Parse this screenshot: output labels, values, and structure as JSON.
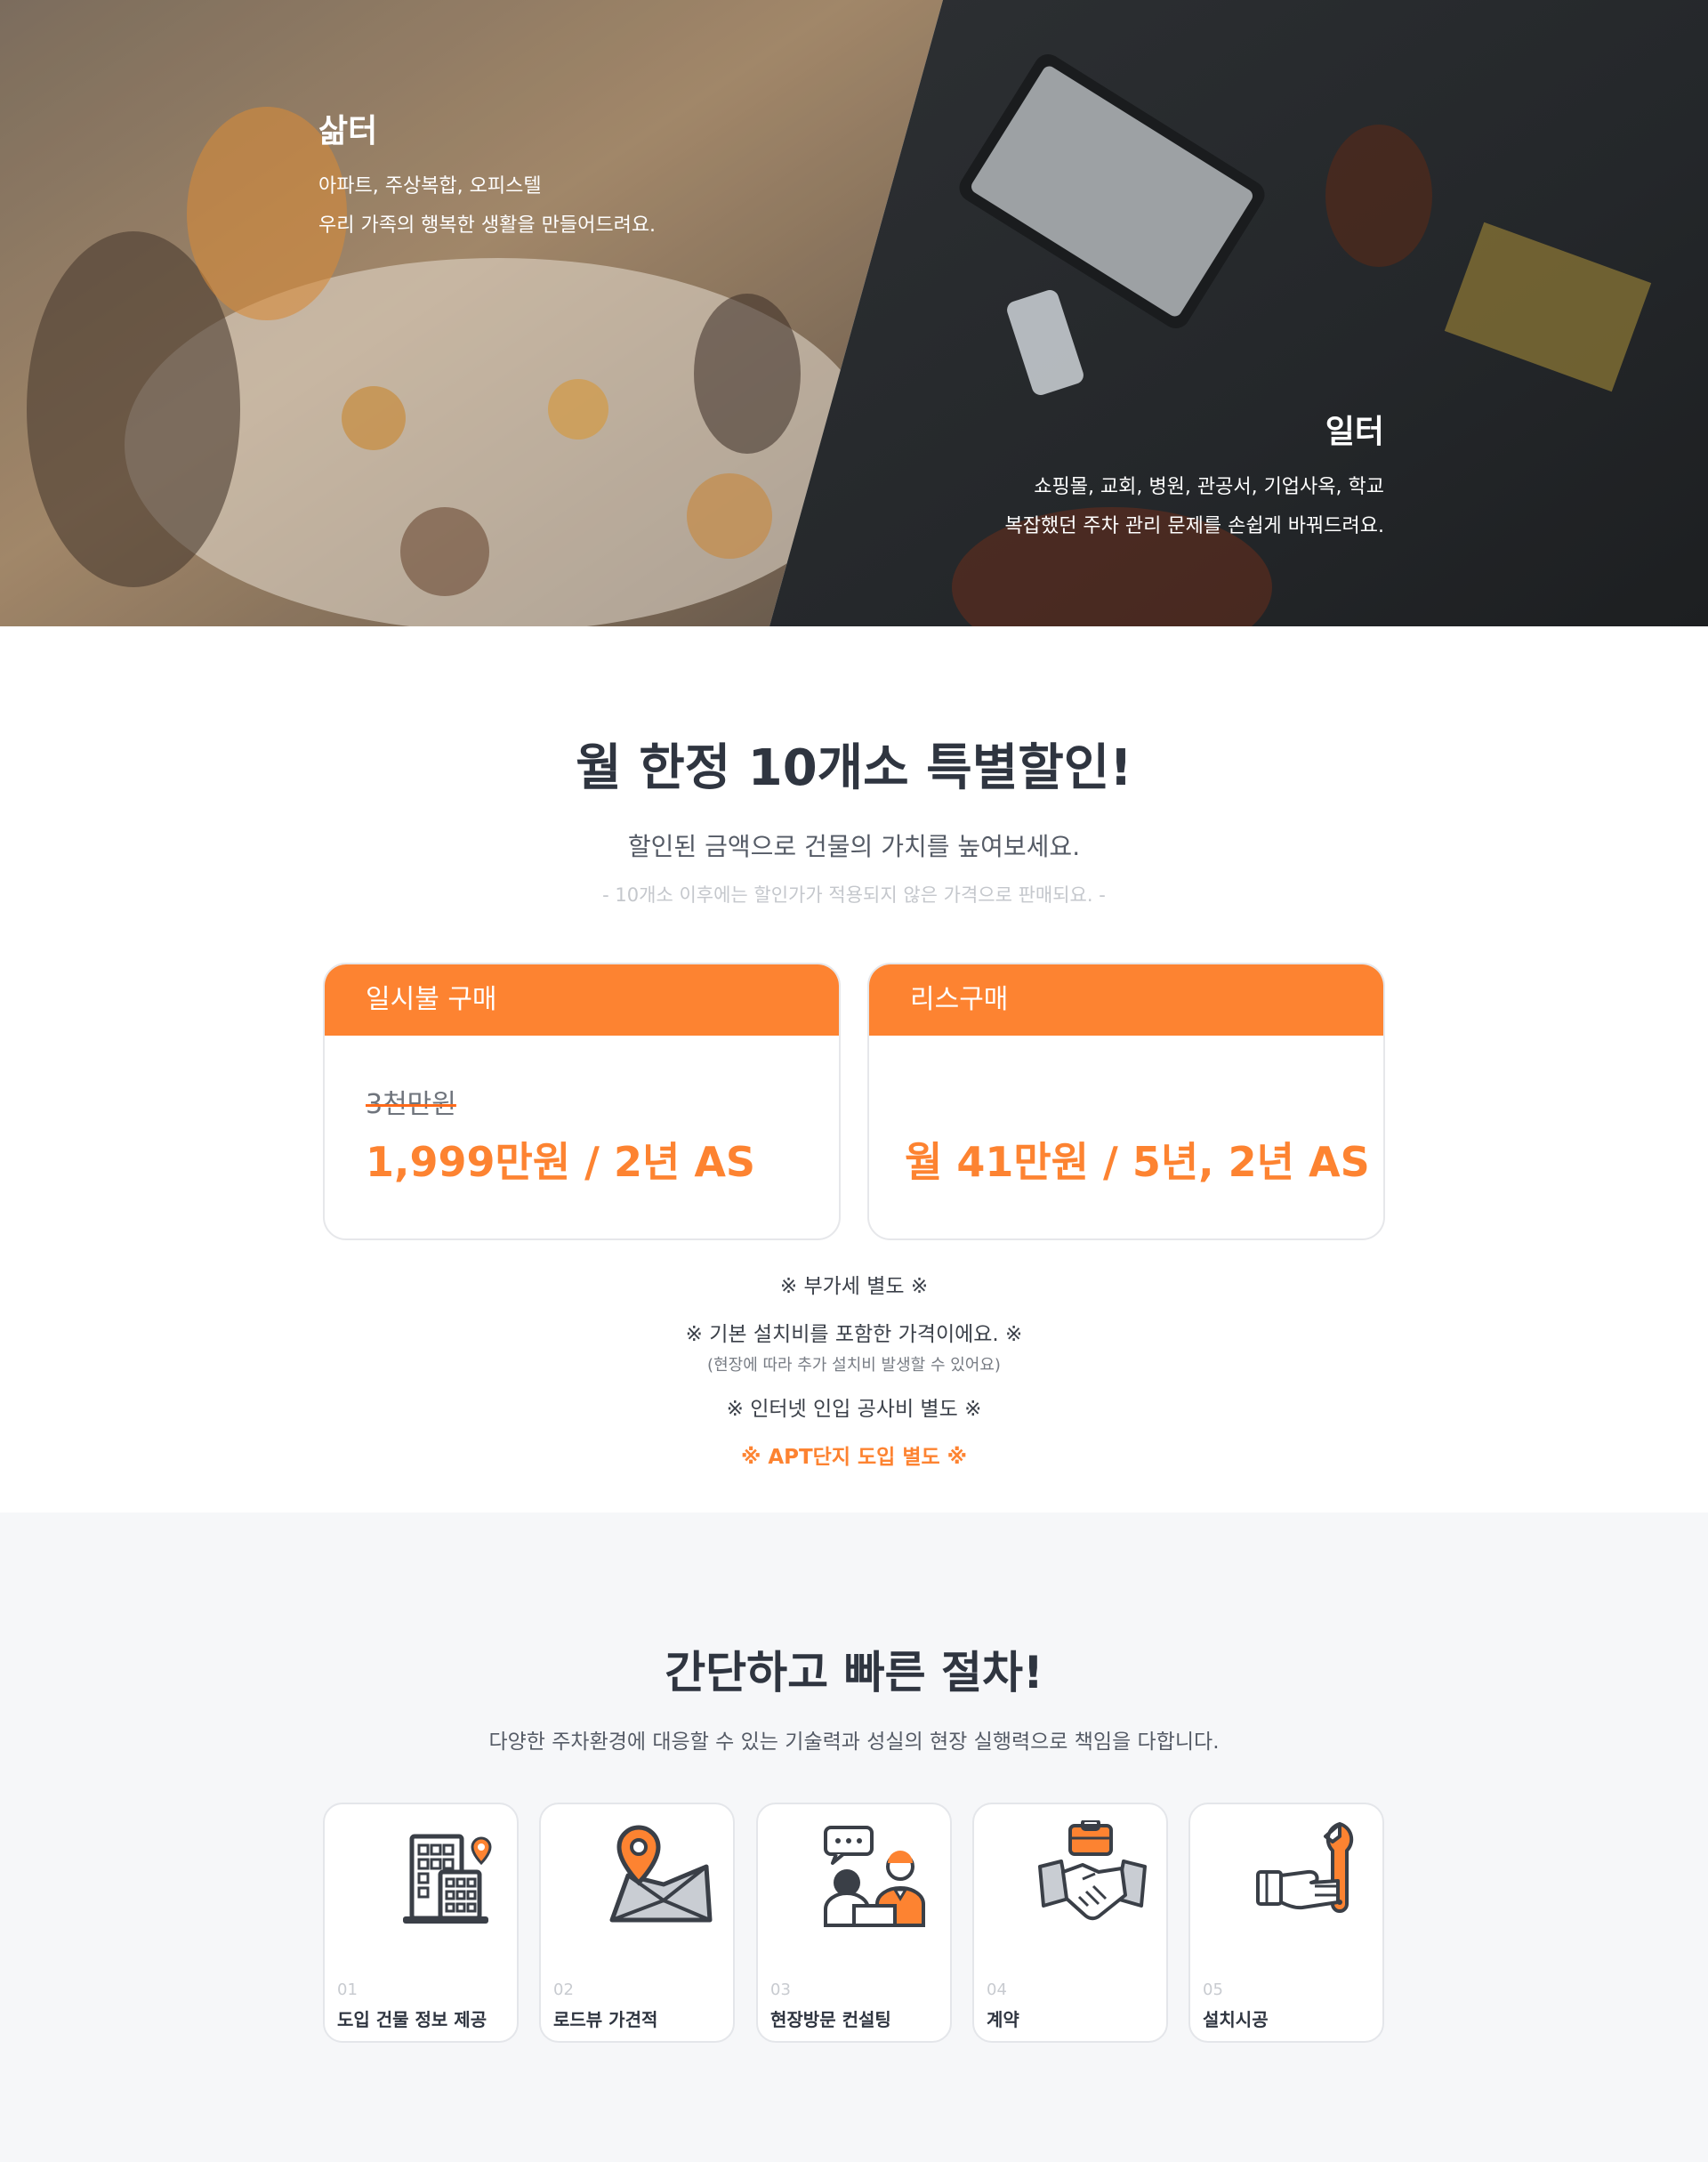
{
  "hero": {
    "left": {
      "title": "삶터",
      "line1": "아파트, 주상복합, 오피스텔",
      "line2": "우리 가족의 행복한 생활을 만들어드려요."
    },
    "right": {
      "title": "일터",
      "line1": "쇼핑몰, 교회, 병원, 관공서, 기업사옥, 학교",
      "line2": "복잡했던 주차 관리 문제를 손쉽게 바꿔드려요."
    }
  },
  "pricing": {
    "title": "월 한정 10개소 특별할인!",
    "subtitle": "할인된 금액으로 건물의 가치를 높여보세요.",
    "note": "- 10개소 이후에는 할인가가 적용되지 않은 가격으로 판매되요. -",
    "cards": [
      {
        "title": "일시불 구매",
        "old_price": "3천만원",
        "price": "1,999만원 / 2년 AS"
      },
      {
        "title": "리스구매",
        "old_price": "",
        "price": "월 41만원 / 5년, 2년 AS"
      }
    ],
    "notes": {
      "vat": "※ 부가세 별도 ※",
      "install": "※ 기본 설치비를 포함한 가격이에요. ※",
      "install_sub": "(현장에 따라 추가 설치비 발생할 수 있어요)",
      "internet": "※ 인터넷 인입 공사비 별도 ※",
      "apt": "※ APT단지 도입 별도 ※"
    }
  },
  "process": {
    "title": "간단하고 빠른 절차!",
    "subtitle": "다양한 주차환경에 대응할 수 있는 기술력과 성실의 현장 실행력으로 책임을 다합니다.",
    "steps": [
      {
        "num": "01",
        "label": "도입 건물 정보 제공",
        "icon": "building-pin-icon"
      },
      {
        "num": "02",
        "label": "로드뷰 가견적",
        "icon": "map-pin-icon"
      },
      {
        "num": "03",
        "label": "현장방문 컨설팅",
        "icon": "consulting-icon"
      },
      {
        "num": "04",
        "label": "계약",
        "icon": "handshake-icon"
      },
      {
        "num": "05",
        "label": "설치시공",
        "icon": "wrench-hand-icon"
      }
    ]
  },
  "colors": {
    "accent": "#fd8331",
    "text": "#2f3540",
    "muted": "#c4c7cc",
    "process_bg": "#f6f7f9"
  }
}
